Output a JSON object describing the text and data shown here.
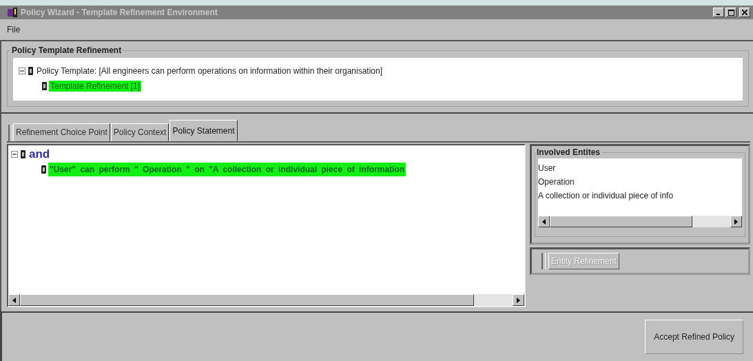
{
  "window": {
    "title": "Policy Wizard - Template Refinement Environment"
  },
  "menu": [
    "File"
  ],
  "template_panel": {
    "title": "Policy Template Refinement",
    "tree": [
      {
        "label": "Policy Template: [All engineers can perform operations on information within their organisation]",
        "selected": false,
        "expanded": true,
        "children": [
          {
            "label": "Template Refinement [1]",
            "selected": true
          }
        ]
      }
    ]
  },
  "tabs": [
    {
      "label": "Refinement Choice Point",
      "selected": false
    },
    {
      "label": "Policy Context",
      "selected": false
    },
    {
      "label": "Policy Statement",
      "selected": true
    }
  ],
  "statement_tree": [
    {
      "label": "and",
      "selected": false,
      "expanded": true,
      "children": [
        {
          "label": "\"User\"  can perform  \" Operation \"  on  \"A collection or individual piece of information",
          "selected": true
        }
      ]
    }
  ],
  "involved_entities": {
    "title": "Involved Entites",
    "items": [
      "User",
      " Operation",
      "A collection or individual piece of info"
    ]
  },
  "entity_refinement_button": {
    "label": "Entity Refinement",
    "disabled": true
  },
  "accept_button": {
    "label": "Accept Refined Policy"
  }
}
